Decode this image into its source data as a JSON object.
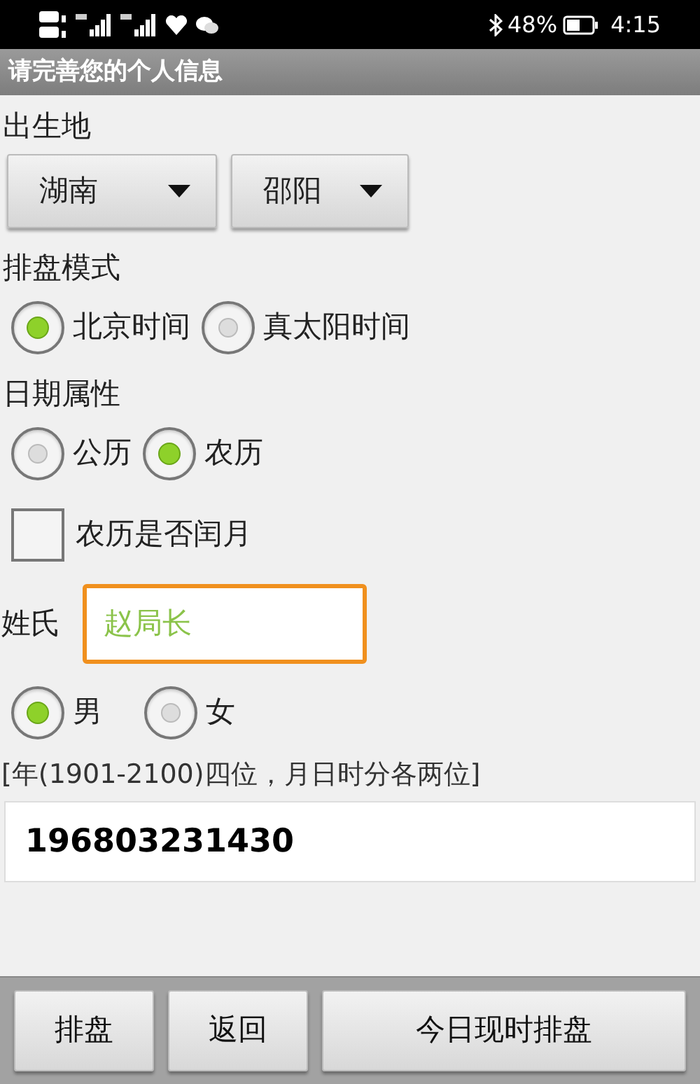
{
  "status_bar": {
    "battery_text": "48%",
    "time": "4:15"
  },
  "title": "请完善您的个人信息",
  "birthplace": {
    "label": "出生地",
    "spinners": [
      {
        "value": "湖南"
      },
      {
        "value": "邵阳"
      }
    ]
  },
  "chart_mode": {
    "label": "排盘模式",
    "options": [
      {
        "label": "北京时间",
        "selected": true
      },
      {
        "label": "真太阳时间",
        "selected": false
      }
    ]
  },
  "date_type": {
    "label": "日期属性",
    "options": [
      {
        "label": "公历",
        "selected": false
      },
      {
        "label": "农历",
        "selected": true
      }
    ]
  },
  "leap_month": {
    "label": "农历是否闰月",
    "checked": false
  },
  "surname": {
    "label": "姓氏",
    "value": "赵局长"
  },
  "gender": {
    "options": [
      {
        "label": "男",
        "selected": true
      },
      {
        "label": "女",
        "selected": false
      }
    ]
  },
  "datetime": {
    "hint": "[年(1901-2100)四位，月日时分各两位]",
    "value": "196803231430"
  },
  "buttons": [
    {
      "label": "排盘",
      "kind": "small"
    },
    {
      "label": "返回",
      "kind": "small"
    },
    {
      "label": "今日现时排盘",
      "kind": "wide"
    }
  ]
}
